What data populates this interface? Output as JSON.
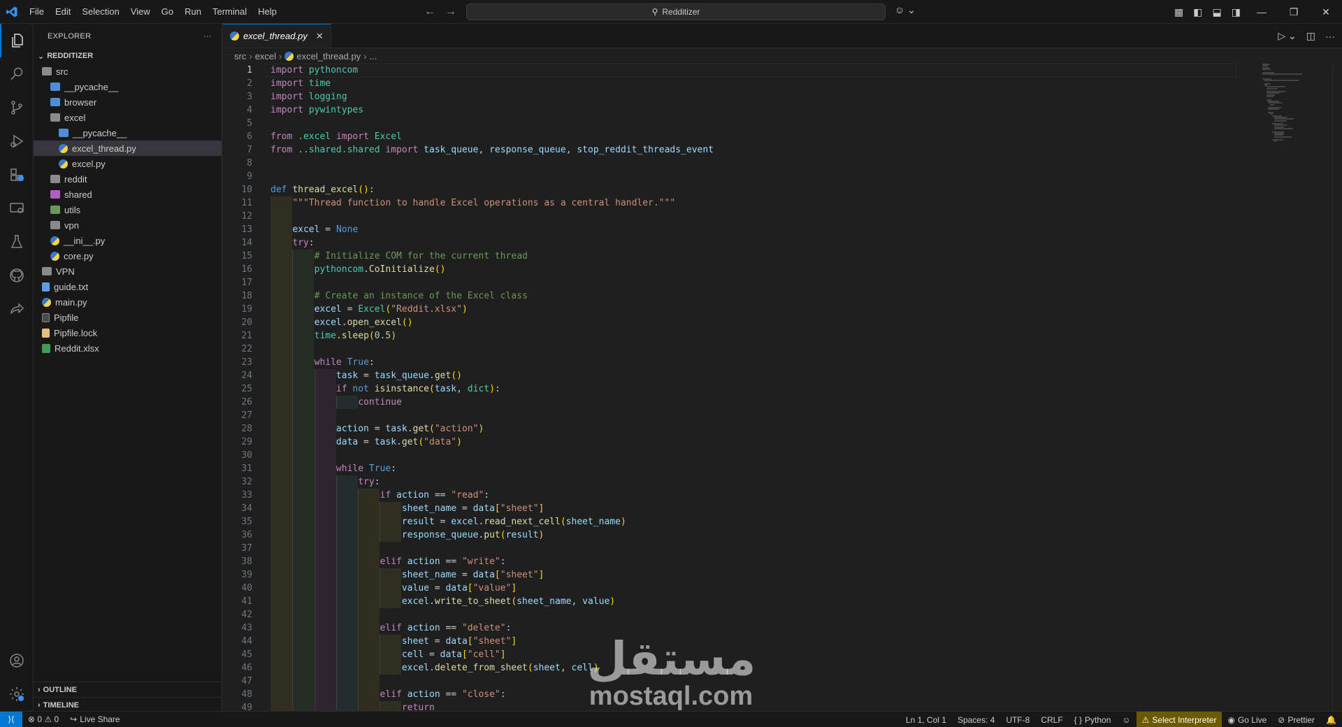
{
  "titlebar": {
    "menu": [
      "File",
      "Edit",
      "Selection",
      "View",
      "Go",
      "Run",
      "Terminal",
      "Help"
    ],
    "search_text": "Redditizer"
  },
  "sidebar": {
    "title": "EXPLORER",
    "more": "···",
    "project": "REDDITIZER",
    "tree": [
      {
        "label": "src",
        "depth": 0,
        "kind": "folder-open"
      },
      {
        "label": "__pycache__",
        "depth": 1,
        "kind": "folder-blue"
      },
      {
        "label": "browser",
        "depth": 1,
        "kind": "folder-blue"
      },
      {
        "label": "excel",
        "depth": 1,
        "kind": "folder-open"
      },
      {
        "label": "__pycache__",
        "depth": 2,
        "kind": "folder-blue"
      },
      {
        "label": "excel_thread.py",
        "depth": 2,
        "kind": "py",
        "selected": true
      },
      {
        "label": "excel.py",
        "depth": 2,
        "kind": "py"
      },
      {
        "label": "reddit",
        "depth": 1,
        "kind": "folder"
      },
      {
        "label": "shared",
        "depth": 1,
        "kind": "folder-purple"
      },
      {
        "label": "utils",
        "depth": 1,
        "kind": "folder-green"
      },
      {
        "label": "vpn",
        "depth": 1,
        "kind": "folder"
      },
      {
        "label": "__ini__.py",
        "depth": 1,
        "kind": "py"
      },
      {
        "label": "core.py",
        "depth": 1,
        "kind": "py"
      },
      {
        "label": "VPN",
        "depth": 0,
        "kind": "folder"
      },
      {
        "label": "guide.txt",
        "depth": 0,
        "kind": "txt"
      },
      {
        "label": "main.py",
        "depth": 0,
        "kind": "py"
      },
      {
        "label": "Pipfile",
        "depth": 0,
        "kind": "pip"
      },
      {
        "label": "Pipfile.lock",
        "depth": 0,
        "kind": "lock"
      },
      {
        "label": "Reddit.xlsx",
        "depth": 0,
        "kind": "xlsx"
      }
    ],
    "outline": "OUTLINE",
    "timeline": "TIMELINE"
  },
  "editor": {
    "tab_label": "excel_thread.py",
    "breadcrumbs": [
      "src",
      "excel",
      "excel_thread.py",
      "..."
    ],
    "current_line": 1,
    "lines": [
      [
        [
          "kw",
          "import"
        ],
        [
          "pun",
          " "
        ],
        [
          "mod",
          "pythoncom"
        ]
      ],
      [
        [
          "kw",
          "import"
        ],
        [
          "pun",
          " "
        ],
        [
          "mod",
          "time"
        ]
      ],
      [
        [
          "kw",
          "import"
        ],
        [
          "pun",
          " "
        ],
        [
          "mod",
          "logging"
        ]
      ],
      [
        [
          "kw",
          "import"
        ],
        [
          "pun",
          " "
        ],
        [
          "mod",
          "pywintypes"
        ]
      ],
      [],
      [
        [
          "kw",
          "from"
        ],
        [
          "pun",
          " "
        ],
        [
          "mod",
          ".excel"
        ],
        [
          "pun",
          " "
        ],
        [
          "kw",
          "import"
        ],
        [
          "pun",
          " "
        ],
        [
          "cls",
          "Excel"
        ]
      ],
      [
        [
          "kw",
          "from"
        ],
        [
          "pun",
          " "
        ],
        [
          "mod",
          "..shared.shared"
        ],
        [
          "pun",
          " "
        ],
        [
          "kw",
          "import"
        ],
        [
          "pun",
          " "
        ],
        [
          "var",
          "task_queue"
        ],
        [
          "pun",
          ", "
        ],
        [
          "var",
          "response_queue"
        ],
        [
          "pun",
          ", "
        ],
        [
          "var",
          "stop_reddit_threads_event"
        ]
      ],
      [],
      [],
      [
        [
          "kwb",
          "def"
        ],
        [
          "pun",
          " "
        ],
        [
          "fn",
          "thread_excel"
        ],
        [
          "br1",
          "()"
        ],
        [
          "pun",
          ":"
        ]
      ],
      [
        [
          "pun",
          "    "
        ],
        [
          "str",
          "\"\"\"Thread function to handle Excel operations as a central handler.\"\"\""
        ]
      ],
      [],
      [
        [
          "pun",
          "    "
        ],
        [
          "var",
          "excel"
        ],
        [
          "pun",
          " = "
        ],
        [
          "kwb",
          "None"
        ]
      ],
      [
        [
          "pun",
          "    "
        ],
        [
          "kw",
          "try"
        ],
        [
          "pun",
          ":"
        ]
      ],
      [
        [
          "pun",
          "        "
        ],
        [
          "cmt",
          "# Initialize COM for the current thread"
        ]
      ],
      [
        [
          "pun",
          "        "
        ],
        [
          "mod",
          "pythoncom"
        ],
        [
          "pun",
          "."
        ],
        [
          "fn",
          "CoInitialize"
        ],
        [
          "br1",
          "()"
        ]
      ],
      [],
      [
        [
          "pun",
          "        "
        ],
        [
          "cmt",
          "# Create an instance of the Excel class"
        ]
      ],
      [
        [
          "pun",
          "        "
        ],
        [
          "var",
          "excel"
        ],
        [
          "pun",
          " = "
        ],
        [
          "cls",
          "Excel"
        ],
        [
          "br1",
          "("
        ],
        [
          "str",
          "\"Reddit.xlsx\""
        ],
        [
          "br1",
          ")"
        ]
      ],
      [
        [
          "pun",
          "        "
        ],
        [
          "var",
          "excel"
        ],
        [
          "pun",
          "."
        ],
        [
          "fn",
          "open_excel"
        ],
        [
          "br1",
          "()"
        ]
      ],
      [
        [
          "pun",
          "        "
        ],
        [
          "mod",
          "time"
        ],
        [
          "pun",
          "."
        ],
        [
          "fn",
          "sleep"
        ],
        [
          "br1",
          "("
        ],
        [
          "num",
          "0.5"
        ],
        [
          "br1",
          ")"
        ]
      ],
      [],
      [
        [
          "pun",
          "        "
        ],
        [
          "kw",
          "while"
        ],
        [
          "pun",
          " "
        ],
        [
          "kwb",
          "True"
        ],
        [
          "pun",
          ":"
        ]
      ],
      [
        [
          "pun",
          "            "
        ],
        [
          "var",
          "task"
        ],
        [
          "pun",
          " = "
        ],
        [
          "var",
          "task_queue"
        ],
        [
          "pun",
          "."
        ],
        [
          "fn",
          "get"
        ],
        [
          "br1",
          "()"
        ]
      ],
      [
        [
          "pun",
          "            "
        ],
        [
          "kw",
          "if"
        ],
        [
          "pun",
          " "
        ],
        [
          "kwb",
          "not"
        ],
        [
          "pun",
          " "
        ],
        [
          "fn",
          "isinstance"
        ],
        [
          "br1",
          "("
        ],
        [
          "var",
          "task"
        ],
        [
          "pun",
          ", "
        ],
        [
          "cls",
          "dict"
        ],
        [
          "br1",
          ")"
        ],
        [
          "pun",
          ":"
        ]
      ],
      [
        [
          "pun",
          "                "
        ],
        [
          "kw",
          "continue"
        ]
      ],
      [],
      [
        [
          "pun",
          "            "
        ],
        [
          "var",
          "action"
        ],
        [
          "pun",
          " = "
        ],
        [
          "var",
          "task"
        ],
        [
          "pun",
          "."
        ],
        [
          "fn",
          "get"
        ],
        [
          "br1",
          "("
        ],
        [
          "str",
          "\"action\""
        ],
        [
          "br1",
          ")"
        ]
      ],
      [
        [
          "pun",
          "            "
        ],
        [
          "var",
          "data"
        ],
        [
          "pun",
          " = "
        ],
        [
          "var",
          "task"
        ],
        [
          "pun",
          "."
        ],
        [
          "fn",
          "get"
        ],
        [
          "br1",
          "("
        ],
        [
          "str",
          "\"data\""
        ],
        [
          "br1",
          ")"
        ]
      ],
      [],
      [
        [
          "pun",
          "            "
        ],
        [
          "kw",
          "while"
        ],
        [
          "pun",
          " "
        ],
        [
          "kwb",
          "True"
        ],
        [
          "pun",
          ":"
        ]
      ],
      [
        [
          "pun",
          "                "
        ],
        [
          "kw",
          "try"
        ],
        [
          "pun",
          ":"
        ]
      ],
      [
        [
          "pun",
          "                    "
        ],
        [
          "kw",
          "if"
        ],
        [
          "pun",
          " "
        ],
        [
          "var",
          "action"
        ],
        [
          "pun",
          " == "
        ],
        [
          "str",
          "\"read\""
        ],
        [
          "pun",
          ":"
        ]
      ],
      [
        [
          "pun",
          "                        "
        ],
        [
          "var",
          "sheet_name"
        ],
        [
          "pun",
          " = "
        ],
        [
          "var",
          "data"
        ],
        [
          "br1",
          "["
        ],
        [
          "str",
          "\"sheet\""
        ],
        [
          "br1",
          "]"
        ]
      ],
      [
        [
          "pun",
          "                        "
        ],
        [
          "var",
          "result"
        ],
        [
          "pun",
          " = "
        ],
        [
          "var",
          "excel"
        ],
        [
          "pun",
          "."
        ],
        [
          "fn",
          "read_next_cell"
        ],
        [
          "br1",
          "("
        ],
        [
          "var",
          "sheet_name"
        ],
        [
          "br1",
          ")"
        ]
      ],
      [
        [
          "pun",
          "                        "
        ],
        [
          "var",
          "response_queue"
        ],
        [
          "pun",
          "."
        ],
        [
          "fn",
          "put"
        ],
        [
          "br1",
          "("
        ],
        [
          "var",
          "result"
        ],
        [
          "br1",
          ")"
        ]
      ],
      [],
      [
        [
          "pun",
          "                    "
        ],
        [
          "kw",
          "elif"
        ],
        [
          "pun",
          " "
        ],
        [
          "var",
          "action"
        ],
        [
          "pun",
          " == "
        ],
        [
          "str",
          "\"write\""
        ],
        [
          "pun",
          ":"
        ]
      ],
      [
        [
          "pun",
          "                        "
        ],
        [
          "var",
          "sheet_name"
        ],
        [
          "pun",
          " = "
        ],
        [
          "var",
          "data"
        ],
        [
          "br1",
          "["
        ],
        [
          "str",
          "\"sheet\""
        ],
        [
          "br1",
          "]"
        ]
      ],
      [
        [
          "pun",
          "                        "
        ],
        [
          "var",
          "value"
        ],
        [
          "pun",
          " = "
        ],
        [
          "var",
          "data"
        ],
        [
          "br1",
          "["
        ],
        [
          "str",
          "\"value\""
        ],
        [
          "br1",
          "]"
        ]
      ],
      [
        [
          "pun",
          "                        "
        ],
        [
          "var",
          "excel"
        ],
        [
          "pun",
          "."
        ],
        [
          "fn",
          "write_to_sheet"
        ],
        [
          "br1",
          "("
        ],
        [
          "var",
          "sheet_name"
        ],
        [
          "pun",
          ", "
        ],
        [
          "var",
          "value"
        ],
        [
          "br1",
          ")"
        ]
      ],
      [],
      [
        [
          "pun",
          "                    "
        ],
        [
          "kw",
          "elif"
        ],
        [
          "pun",
          " "
        ],
        [
          "var",
          "action"
        ],
        [
          "pun",
          " == "
        ],
        [
          "str",
          "\"delete\""
        ],
        [
          "pun",
          ":"
        ]
      ],
      [
        [
          "pun",
          "                        "
        ],
        [
          "var",
          "sheet"
        ],
        [
          "pun",
          " = "
        ],
        [
          "var",
          "data"
        ],
        [
          "br1",
          "["
        ],
        [
          "str",
          "\"sheet\""
        ],
        [
          "br1",
          "]"
        ]
      ],
      [
        [
          "pun",
          "                        "
        ],
        [
          "var",
          "cell"
        ],
        [
          "pun",
          " = "
        ],
        [
          "var",
          "data"
        ],
        [
          "br1",
          "["
        ],
        [
          "str",
          "\"cell\""
        ],
        [
          "br1",
          "]"
        ]
      ],
      [
        [
          "pun",
          "                        "
        ],
        [
          "var",
          "excel"
        ],
        [
          "pun",
          "."
        ],
        [
          "fn",
          "delete_from_sheet"
        ],
        [
          "br1",
          "("
        ],
        [
          "var",
          "sheet"
        ],
        [
          "pun",
          ", "
        ],
        [
          "var",
          "cell"
        ],
        [
          "br1",
          ")"
        ]
      ],
      [],
      [
        [
          "pun",
          "                    "
        ],
        [
          "kw",
          "elif"
        ],
        [
          "pun",
          " "
        ],
        [
          "var",
          "action"
        ],
        [
          "pun",
          " == "
        ],
        [
          "str",
          "\"close\""
        ],
        [
          "pun",
          ":"
        ]
      ],
      [
        [
          "pun",
          "                        "
        ],
        [
          "kw",
          "return"
        ]
      ]
    ]
  },
  "watermark": {
    "arabic": "مستقل",
    "latin": "mostaql.com"
  },
  "statusbar": {
    "problems": "⊗ 0 ⚠ 0",
    "liveshare": "Live Share",
    "position": "Ln 1, Col 1",
    "spaces": "Spaces: 4",
    "encoding": "UTF-8",
    "eol": "CRLF",
    "language": "Python",
    "interpreter": "Select Interpreter",
    "golive": "Go Live",
    "prettier": "Prettier"
  }
}
